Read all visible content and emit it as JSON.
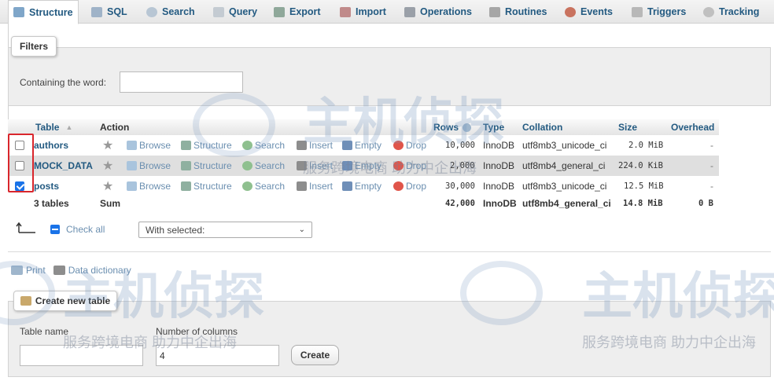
{
  "tabs": [
    {
      "label": "Structure",
      "icon": "structure-icon",
      "active": true
    },
    {
      "label": "SQL",
      "icon": "sql-icon"
    },
    {
      "label": "Search",
      "icon": "search-icon"
    },
    {
      "label": "Query",
      "icon": "query-icon"
    },
    {
      "label": "Export",
      "icon": "export-icon"
    },
    {
      "label": "Import",
      "icon": "import-icon"
    },
    {
      "label": "Operations",
      "icon": "wrench-icon"
    },
    {
      "label": "Routines",
      "icon": "routines-icon"
    },
    {
      "label": "Events",
      "icon": "clock-icon"
    },
    {
      "label": "Triggers",
      "icon": "triggers-icon"
    },
    {
      "label": "Tracking",
      "icon": "eye-icon"
    }
  ],
  "filters": {
    "legend": "Filters",
    "label": "Containing the word:",
    "value": ""
  },
  "table": {
    "headers": {
      "table": "Table",
      "action": "Action",
      "rows": "Rows",
      "type": "Type",
      "collation": "Collation",
      "size": "Size",
      "overhead": "Overhead"
    },
    "actions": [
      "Browse",
      "Structure",
      "Search",
      "Insert",
      "Empty",
      "Drop"
    ],
    "rows": [
      {
        "name": "authors",
        "checked": false,
        "rows": "10,000",
        "type": "InnoDB",
        "collation": "utf8mb3_unicode_ci",
        "size": "2.0 MiB",
        "overhead": "-"
      },
      {
        "name": "MOCK_DATA",
        "checked": false,
        "rows": "2,000",
        "type": "InnoDB",
        "collation": "utf8mb4_general_ci",
        "size": "224.0 KiB",
        "overhead": "-"
      },
      {
        "name": "posts",
        "checked": true,
        "rows": "30,000",
        "type": "InnoDB",
        "collation": "utf8mb3_unicode_ci",
        "size": "12.5 MiB",
        "overhead": "-"
      }
    ],
    "footer": {
      "tables": "3 tables",
      "sum": "Sum",
      "rows": "42,000",
      "type": "InnoDB",
      "collation": "utf8mb4_general_ci",
      "size": "14.8 MiB",
      "overhead": "0 B"
    }
  },
  "bulk": {
    "check_all": "Check all",
    "with_selected": "With selected:"
  },
  "links": {
    "print": "Print",
    "data_dictionary": "Data dictionary"
  },
  "create": {
    "legend": "Create new table",
    "table_name_label": "Table name",
    "table_name_value": "",
    "columns_label": "Number of columns",
    "columns_value": "4",
    "button": "Create"
  },
  "watermark": {
    "brand": "主机侦探",
    "slogan": "服务跨境电商 助力中企出海"
  },
  "colors": {
    "link": "#235a81",
    "action_link": "#6b8fb0",
    "highlight_border": "#d9262c",
    "checkbox_checked": "#1a73e8"
  }
}
